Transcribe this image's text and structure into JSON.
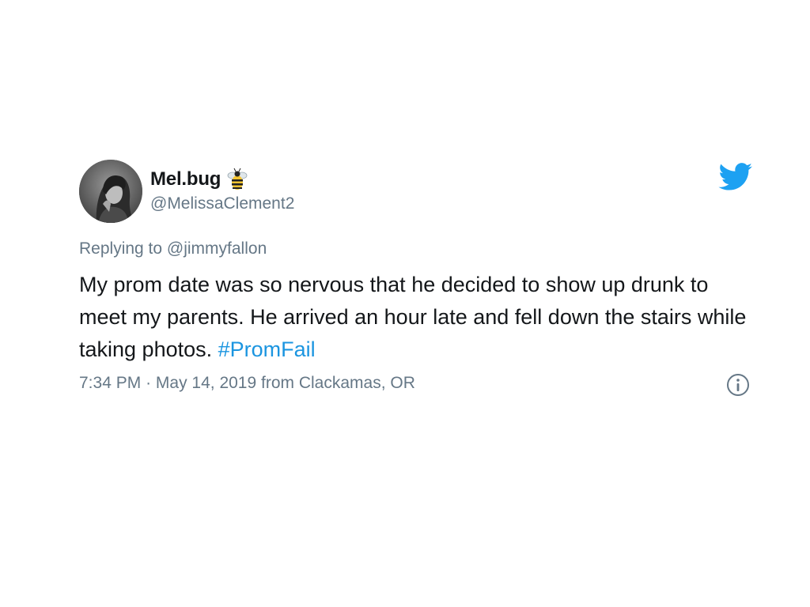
{
  "user": {
    "display_name": "Mel.bug",
    "handle": "@MelissaClement2",
    "badge_icon": "bee-icon",
    "avatar": "profile-photo"
  },
  "platform_icon": "twitter-bird-icon",
  "reply": {
    "prefix": "Replying to",
    "mention": "@jimmyfallon"
  },
  "tweet": {
    "text": "My prom date was so nervous that he decided to show up drunk to meet my parents. He arrived an hour late and fell down the stairs while taking photos.",
    "hashtag": "#PromFail"
  },
  "meta": {
    "time": "7:34 PM",
    "separator": "·",
    "date_location": "May 14, 2019 from Clackamas, OR"
  },
  "info_icon": "info-icon",
  "colors": {
    "text": "#14171a",
    "secondary": "#657786",
    "link": "#1b95e0",
    "twitter_blue": "#1da1f2"
  }
}
